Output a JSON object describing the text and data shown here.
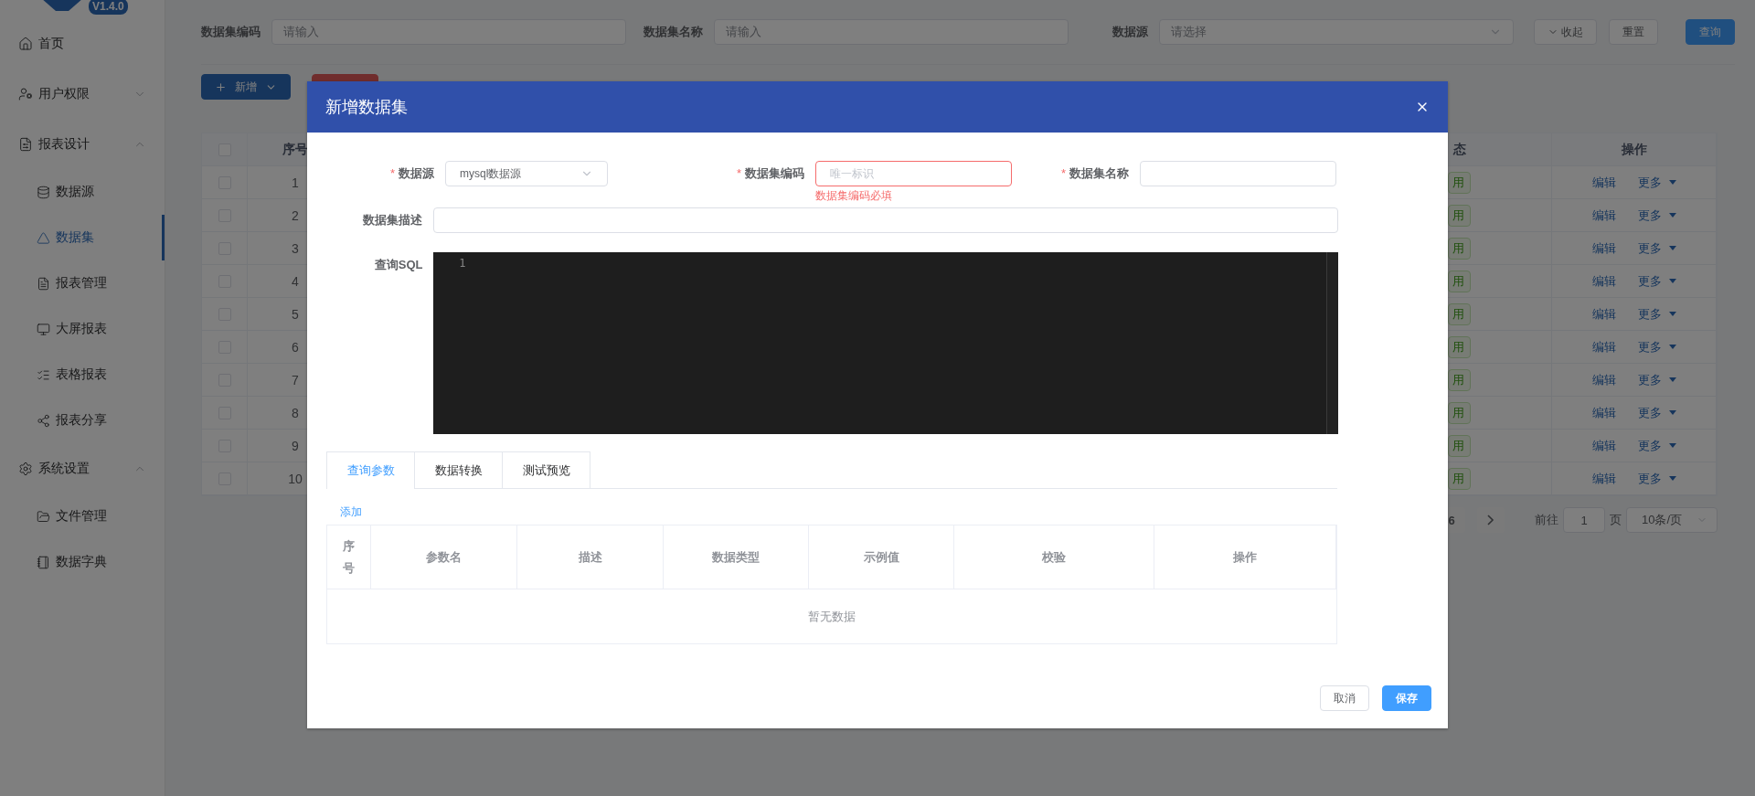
{
  "sidebar": {
    "version": "V1.4.0",
    "items": [
      {
        "label": "首页",
        "selected": false
      },
      {
        "label": "用户权限",
        "selected": false,
        "expanded": false
      },
      {
        "label": "报表设计",
        "selected": false,
        "expanded": true,
        "children": [
          {
            "label": "数据源",
            "selected": false
          },
          {
            "label": "数据集",
            "selected": true
          },
          {
            "label": "报表管理",
            "selected": false
          },
          {
            "label": "大屏报表",
            "selected": false
          },
          {
            "label": "表格报表",
            "selected": false
          },
          {
            "label": "报表分享",
            "selected": false
          }
        ]
      },
      {
        "label": "系统设置",
        "selected": false,
        "expanded": true,
        "children": [
          {
            "label": "文件管理",
            "selected": false
          },
          {
            "label": "数据字典",
            "selected": false
          }
        ]
      }
    ]
  },
  "filters": [
    {
      "label": "数据集编码",
      "kind": "input",
      "placeholder": "请输入"
    },
    {
      "label": "数据集名称",
      "kind": "input",
      "placeholder": "请输入"
    },
    {
      "label": "数据源",
      "kind": "select",
      "placeholder": "请选择"
    }
  ],
  "filter_buttons": [
    {
      "label": "收起",
      "kind": "collapse"
    },
    {
      "label": "重置",
      "kind": "plain"
    },
    {
      "label": "查询",
      "kind": "primary"
    }
  ],
  "toolbar": [
    {
      "label": "新增",
      "kind": "add"
    },
    {
      "kind": "danger"
    }
  ],
  "table": {
    "header_checked": false,
    "index_header": "序号",
    "status_header": "态",
    "actions_header": "操作",
    "rows": [
      {
        "index": "1",
        "status": "用",
        "checked": false,
        "actions": [
          "编辑",
          "更多"
        ]
      },
      {
        "index": "2",
        "status": "用",
        "checked": false,
        "actions": [
          "编辑",
          "更多"
        ]
      },
      {
        "index": "3",
        "status": "用",
        "checked": false,
        "actions": [
          "编辑",
          "更多"
        ]
      },
      {
        "index": "4",
        "status": "用",
        "checked": false,
        "actions": [
          "编辑",
          "更多"
        ]
      },
      {
        "index": "5",
        "status": "用",
        "checked": false,
        "actions": [
          "编辑",
          "更多"
        ]
      },
      {
        "index": "6",
        "status": "用",
        "checked": false,
        "actions": [
          "编辑",
          "更多"
        ]
      },
      {
        "index": "7",
        "status": "用",
        "checked": false,
        "actions": [
          "编辑",
          "更多"
        ]
      },
      {
        "index": "8",
        "status": "用",
        "checked": false,
        "actions": [
          "编辑",
          "更多"
        ]
      },
      {
        "index": "9",
        "status": "用",
        "checked": false,
        "actions": [
          "编辑",
          "更多"
        ]
      },
      {
        "index": "10",
        "status": "用",
        "checked": false,
        "actions": [
          "编辑",
          "更多"
        ]
      }
    ]
  },
  "pagination": {
    "page": "6",
    "goto_label": "前往",
    "goto_value": "1",
    "goto_suffix": "页",
    "page_size": "10条/页"
  },
  "dialog": {
    "title": "新增数据集",
    "rows": [
      [
        {
          "label": "数据源",
          "required_mark": "*",
          "kind": "select",
          "value": "mysql数据源"
        },
        {
          "label": "数据集编码",
          "required_mark": "*",
          "kind": "input",
          "placeholder": "唯一标识",
          "error": "数据集编码必填"
        },
        {
          "label": "数据集名称",
          "required_mark": "*",
          "kind": "input"
        }
      ],
      [
        {
          "label": "数据集描述",
          "kind": "input"
        }
      ],
      [
        {
          "label": "查询SQL",
          "kind": "code",
          "line_numbers": [
            "1"
          ]
        }
      ]
    ],
    "tabs": [
      {
        "label": "查询参数",
        "selected": true
      },
      {
        "label": "数据转换",
        "selected": false
      },
      {
        "label": "测试预览",
        "selected": false
      }
    ],
    "add_link": "添加",
    "param_columns": [
      "序号",
      "参数名",
      "描述",
      "数据类型",
      "示例值",
      "校验",
      "操作"
    ],
    "empty_text": "暂无数据",
    "buttons": [
      {
        "label": "取消",
        "kind": "plain"
      },
      {
        "label": "保存",
        "kind": "primary"
      }
    ]
  }
}
